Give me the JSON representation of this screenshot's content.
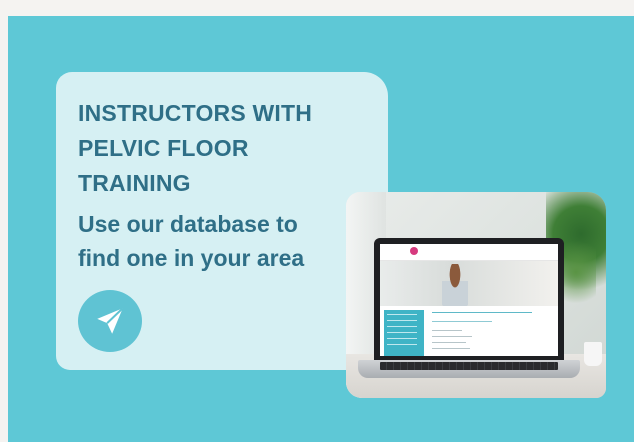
{
  "card": {
    "title": "INSTRUCTORS WITH\nPELVIC FLOOR\nTRAINING",
    "subtitle": "Use our database to\nfind one in your area",
    "button_icon": "paper-plane-icon"
  },
  "photo": {
    "alt": "Laptop showing pelvic floor safe fitness instructors database"
  },
  "colors": {
    "banner": "#5ec8d6",
    "card": "#d6f0f3",
    "text": "#2f6f87",
    "button": "#5fc3d3"
  }
}
